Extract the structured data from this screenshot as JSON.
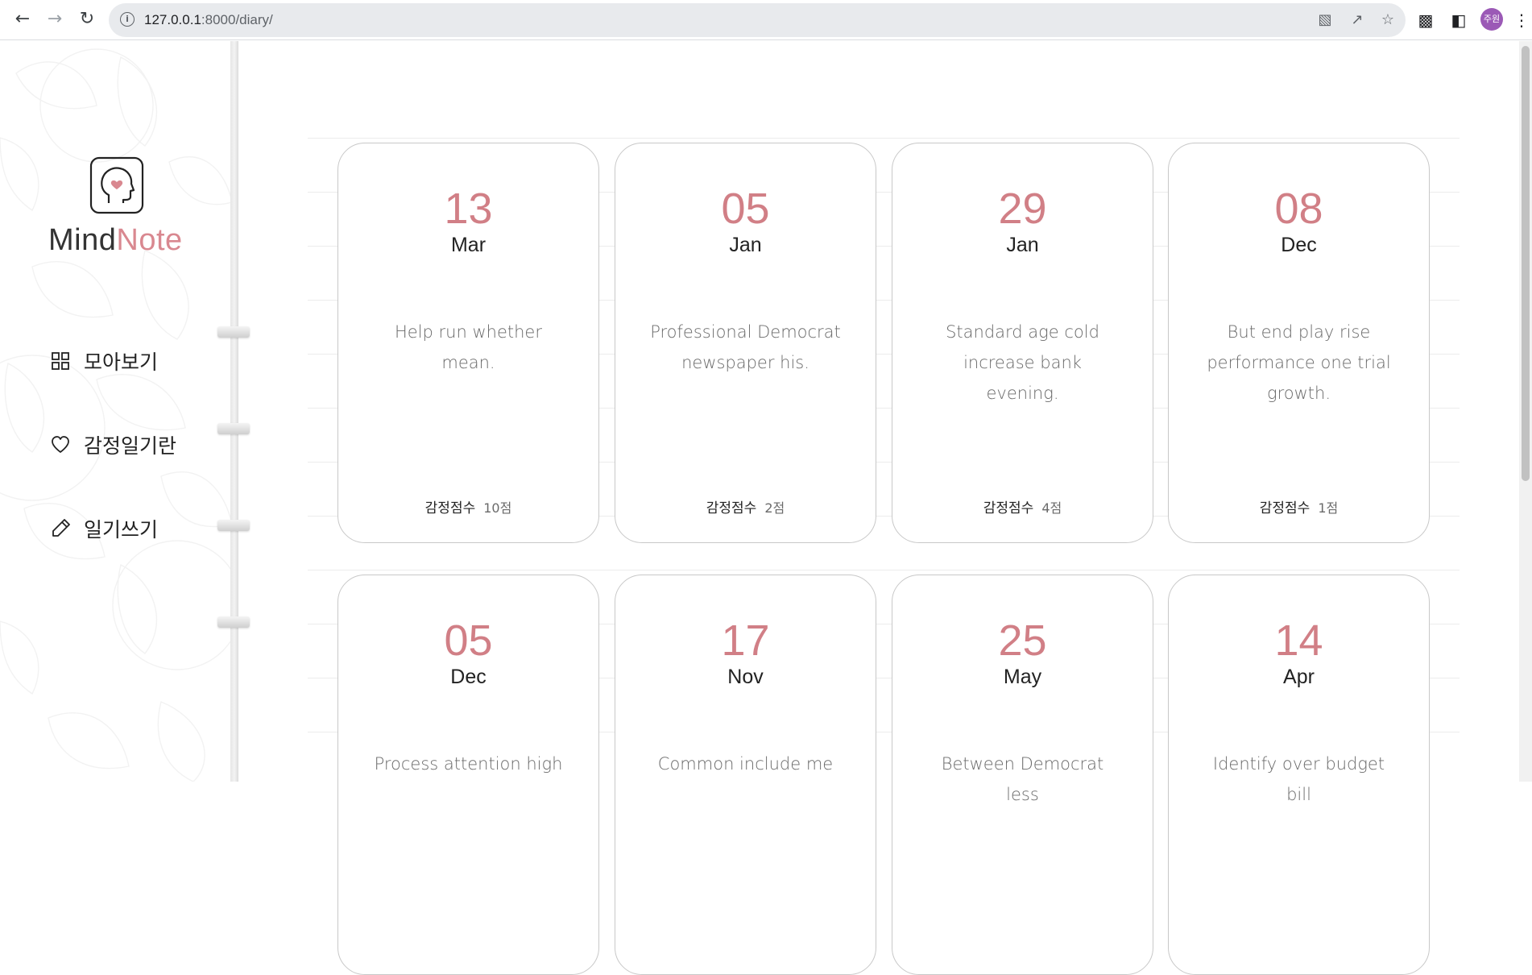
{
  "browser": {
    "url_host": "127.0.0.1",
    "url_path": ":8000/diary/",
    "profile_label": "주원"
  },
  "sidebar": {
    "brand_mind": "Mind",
    "brand_note": "Note",
    "menu": [
      {
        "label": "모아보기",
        "icon": "grid-icon"
      },
      {
        "label": "감정일기란",
        "icon": "heart-icon"
      },
      {
        "label": "일기쓰기",
        "icon": "pencil-icon"
      }
    ]
  },
  "cards": [
    {
      "day": "13",
      "month": "Mar",
      "text": "Help run whether mean.",
      "score_label": "감정점수",
      "score": "10점"
    },
    {
      "day": "05",
      "month": "Jan",
      "text": "Professional Democrat newspaper his.",
      "score_label": "감정점수",
      "score": "2점"
    },
    {
      "day": "29",
      "month": "Jan",
      "text": "Standard age cold increase bank evening.",
      "score_label": "감정점수",
      "score": "4점"
    },
    {
      "day": "08",
      "month": "Dec",
      "text": "But end play rise performance one trial growth.",
      "score_label": "감정점수",
      "score": "1점"
    },
    {
      "day": "05",
      "month": "Dec",
      "text": "Process attention high",
      "score_label": "",
      "score": ""
    },
    {
      "day": "17",
      "month": "Nov",
      "text": "Common include me",
      "score_label": "",
      "score": ""
    },
    {
      "day": "25",
      "month": "May",
      "text": "Between Democrat less",
      "score_label": "",
      "score": ""
    },
    {
      "day": "14",
      "month": "Apr",
      "text": "Identify over budget bill",
      "score_label": "",
      "score": ""
    }
  ],
  "colors": {
    "accent": "#d17f86",
    "brand_note": "#d98890",
    "card_border": "#c8c8c8"
  }
}
